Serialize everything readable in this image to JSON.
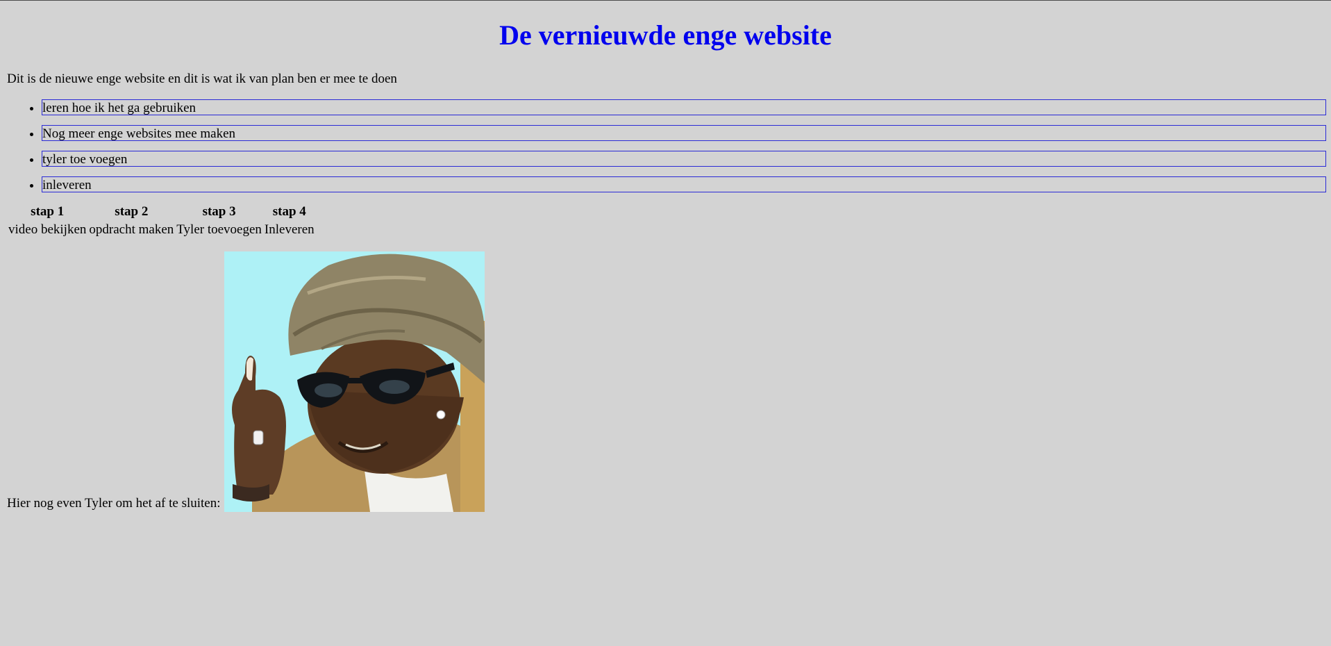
{
  "header": {
    "title": "De vernieuwde enge website"
  },
  "intro": {
    "text": "Dit is de nieuwe enge website en dit is wat ik van plan ben er mee te doen"
  },
  "plan": {
    "items": [
      {
        "label": "leren hoe ik het ga gebruiken"
      },
      {
        "label": "Nog meer enge websites mee maken"
      },
      {
        "label": "tyler toe voegen"
      },
      {
        "label": "inleveren"
      }
    ]
  },
  "steps": {
    "headers": [
      "stap 1",
      "stap 2",
      "stap 3",
      "stap 4"
    ],
    "cells": [
      "video bekijken",
      "opdracht maken",
      "Tyler toevoegen",
      "Inleveren"
    ]
  },
  "closing": {
    "text": "Hier nog even Tyler om het af te sluiten:"
  },
  "colors": {
    "background": "#d3d3d3",
    "title": "#0000ee",
    "list_border": "#2a2ad6",
    "photo_sky": "#aef1f6"
  }
}
